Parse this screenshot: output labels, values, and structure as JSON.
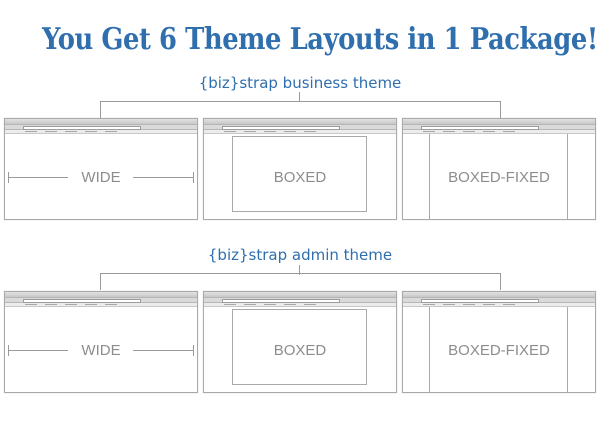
{
  "headline": "You Get 6 Theme Layouts in 1 Package!",
  "sections": [
    {
      "title": "{biz}strap business theme",
      "layouts": [
        "WIDE",
        "BOXED",
        "BOXED-FIXED"
      ]
    },
    {
      "title": "{biz}strap admin theme",
      "layouts": [
        "WIDE",
        "BOXED",
        "BOXED-FIXED"
      ]
    }
  ],
  "colors": {
    "accent": "#2f6fae",
    "label_gray": "#8d8d8d",
    "line_gray": "#9a9a9a",
    "traffic_red": "#e0564a",
    "traffic_yellow": "#e5b63a",
    "traffic_green": "#6fbf4a"
  }
}
